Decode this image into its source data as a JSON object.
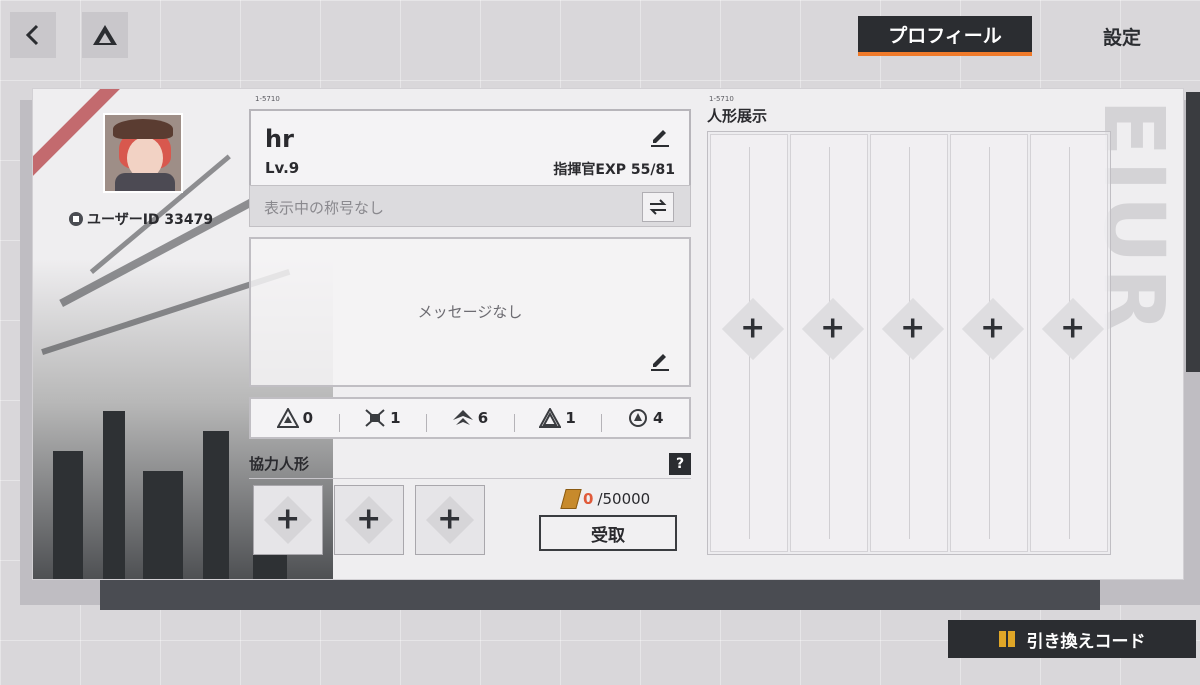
{
  "nav": {
    "tabs": [
      {
        "label": "プロフィール",
        "active": true
      },
      {
        "label": "設定",
        "active": false
      }
    ]
  },
  "profile": {
    "user_id_label": "ユーザーID 33479",
    "serial_a": "1-5710",
    "serial_b": "1-5710",
    "name": "hr",
    "level": "Lv.9",
    "exp": "指揮官EXP 55/81",
    "title_placeholder": "表示中の称号なし",
    "message": "メッセージなし"
  },
  "medals": [
    {
      "icon": "triangle-medal-icon",
      "count": "0"
    },
    {
      "icon": "crossed-medal-icon",
      "count": "1"
    },
    {
      "icon": "wing-medal-icon",
      "count": "6"
    },
    {
      "icon": "pyramid-medal-icon",
      "count": "1"
    },
    {
      "icon": "circle-medal-icon",
      "count": "4"
    }
  ],
  "coop": {
    "label": "協力人形",
    "help": "?",
    "slots": 3,
    "reward_current": "0",
    "reward_max": "/50000",
    "claim_label": "受取"
  },
  "showcase": {
    "label": "人形展示",
    "slots": 5
  },
  "redeem": {
    "label": "引き換えコード"
  },
  "colors": {
    "accent": "#f07a2a",
    "dark": "#2b2d31",
    "reward_current": "#e05a3a"
  }
}
